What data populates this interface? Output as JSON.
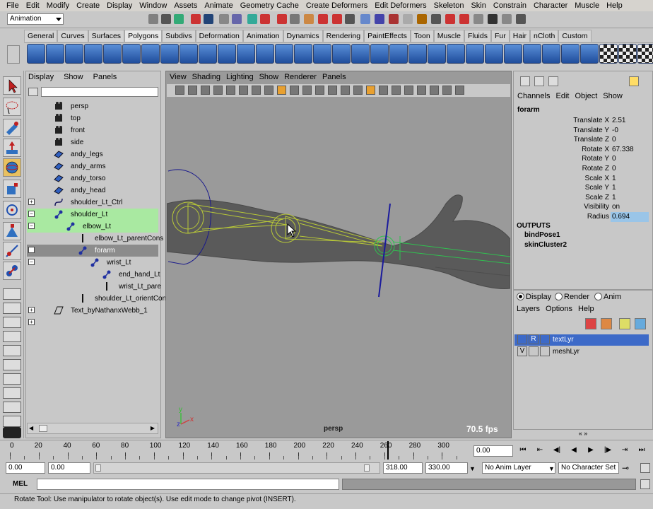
{
  "menubar": [
    "File",
    "Edit",
    "Modify",
    "Create",
    "Display",
    "Window",
    "Assets",
    "Animate",
    "Geometry Cache",
    "Create Deformers",
    "Edit Deformers",
    "Skeleton",
    "Skin",
    "Constrain",
    "Character",
    "Muscle",
    "Help"
  ],
  "mode_selector": "Animation",
  "shelf_tabs": [
    "General",
    "Curves",
    "Surfaces",
    "Polygons",
    "Subdivs",
    "Deformation",
    "Animation",
    "Dynamics",
    "Rendering",
    "PaintEffects",
    "Toon",
    "Muscle",
    "Fluids",
    "Fur",
    "Hair",
    "nCloth",
    "Custom"
  ],
  "active_shelf_tab": "Polygons",
  "outliner": {
    "menu": [
      "Display",
      "Show",
      "Panels"
    ],
    "items": [
      {
        "label": "persp",
        "icon": "camera-icon",
        "indent": 0,
        "expand": ""
      },
      {
        "label": "top",
        "icon": "camera-icon",
        "indent": 0,
        "expand": ""
      },
      {
        "label": "front",
        "icon": "camera-icon",
        "indent": 0,
        "expand": ""
      },
      {
        "label": "side",
        "icon": "camera-icon",
        "indent": 0,
        "expand": ""
      },
      {
        "label": "andy_legs",
        "icon": "mesh-icon",
        "indent": 0,
        "expand": ""
      },
      {
        "label": "andy_arms",
        "icon": "mesh-icon",
        "indent": 0,
        "expand": ""
      },
      {
        "label": "andy_torso",
        "icon": "mesh-icon",
        "indent": 0,
        "expand": ""
      },
      {
        "label": "andy_head",
        "icon": "mesh-icon",
        "indent": 0,
        "expand": ""
      },
      {
        "label": "shoulder_Lt_Ctrl",
        "icon": "curve-icon",
        "indent": 0,
        "expand": "+"
      },
      {
        "label": "shoulder_Lt",
        "icon": "joint-icon",
        "indent": 0,
        "expand": "−",
        "sel": "green"
      },
      {
        "label": "elbow_Lt",
        "icon": "joint-icon",
        "indent": 1,
        "expand": "−",
        "sel": "green"
      },
      {
        "label": "elbow_Lt_parentCons",
        "icon": "constraint-icon",
        "indent": 2,
        "expand": ""
      },
      {
        "label": "forarm",
        "icon": "joint-icon",
        "indent": 2,
        "expand": "−",
        "sel": "gray"
      },
      {
        "label": "wrist_Lt",
        "icon": "joint-icon",
        "indent": 3,
        "expand": "−"
      },
      {
        "label": "end_hand_Lt",
        "icon": "joint-icon",
        "indent": 4,
        "expand": ""
      },
      {
        "label": "wrist_Lt_pare",
        "icon": "constraint-icon",
        "indent": 4,
        "expand": ""
      },
      {
        "label": "shoulder_Lt_orientConstra",
        "icon": "constraint-icon",
        "indent": 2,
        "expand": ""
      },
      {
        "label": "Text_byNathanxWebb_1",
        "icon": "transform-icon",
        "indent": 0,
        "expand": "+"
      },
      {
        "label": "",
        "icon": "",
        "indent": 0,
        "expand": "+"
      }
    ]
  },
  "viewport": {
    "menu": [
      "View",
      "Shading",
      "Lighting",
      "Show",
      "Renderer",
      "Panels"
    ],
    "camera_label": "persp",
    "fps": "70.5 fps",
    "axis_x": "x",
    "axis_y": "y",
    "axis_z": "z"
  },
  "channel_box": {
    "menu": [
      "Channels",
      "Edit",
      "Object",
      "Show"
    ],
    "object": "forarm",
    "channels": [
      {
        "label": "Translate X",
        "value": "2.51"
      },
      {
        "label": "Translate Y",
        "value": "-0"
      },
      {
        "label": "Translate Z",
        "value": "0"
      },
      {
        "label": "Rotate X",
        "value": "67.338"
      },
      {
        "label": "Rotate Y",
        "value": "0"
      },
      {
        "label": "Rotate Z",
        "value": "0"
      },
      {
        "label": "Scale X",
        "value": "1"
      },
      {
        "label": "Scale Y",
        "value": "1"
      },
      {
        "label": "Scale Z",
        "value": "1"
      },
      {
        "label": "Visibility",
        "value": "on"
      },
      {
        "label": "Radius",
        "value": "0.694",
        "selected": true
      }
    ],
    "outputs_label": "OUTPUTS",
    "outputs": [
      "bindPose1",
      "skinCluster2"
    ]
  },
  "layer_editor": {
    "radios": [
      {
        "label": "Display",
        "on": true
      },
      {
        "label": "Render",
        "on": false
      },
      {
        "label": "Anim",
        "on": false
      }
    ],
    "menu": [
      "Layers",
      "Options",
      "Help"
    ],
    "layers": [
      {
        "v": "",
        "r": "R",
        "name": "textLyr",
        "selected": true
      },
      {
        "v": "V",
        "r": "",
        "name": "meshLyr",
        "selected": false
      }
    ]
  },
  "timeline": {
    "ticks": [
      "0",
      "20",
      "40",
      "60",
      "80",
      "100",
      "120",
      "140",
      "160",
      "180",
      "200",
      "220",
      "240",
      "260",
      "280",
      "300"
    ],
    "playhead_frame": 260,
    "current_time": "0.00"
  },
  "range_slider": {
    "start": "0.00",
    "playback_start": "0.00",
    "playback_end": "318.00",
    "end": "330.00",
    "anim_layer": "No Anim Layer",
    "char_set": "No Character Set"
  },
  "command_line": {
    "label": "MEL",
    "value": ""
  },
  "help_line": "Rotate Tool: Use manipulator to rotate object(s). Use edit mode to change pivot (INSERT).",
  "colors": {
    "ui_bg": "#c8c8c8",
    "viewport_bg": "#9a9a9a",
    "selection_green": "#a9e9a1",
    "selection_blue": "#3d6ac8",
    "joint_color": "#2030a0"
  }
}
